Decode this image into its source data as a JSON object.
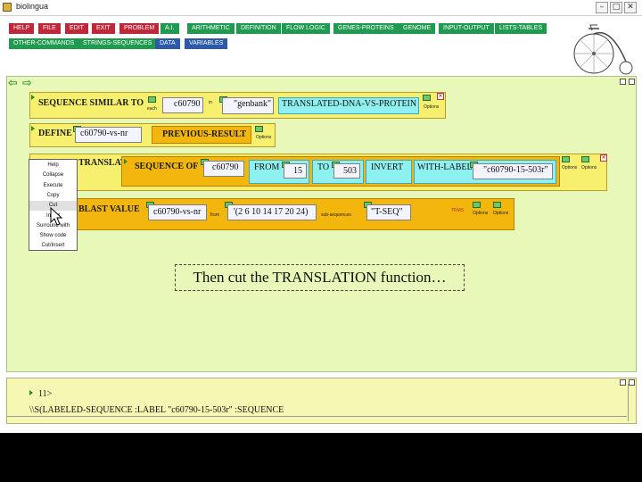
{
  "window": {
    "title": "biolingua"
  },
  "colors": {
    "help": "#c0283a",
    "file": "#c0283a",
    "edit": "#c0283a",
    "exit": "#c0283a",
    "problem": "#c0283a",
    "green_cmd": "#1f9a4f",
    "blue_cmd": "#2d5aa8",
    "workspace": "#e7f8b8",
    "function_yellow": "#f7f06f",
    "function_orange": "#f2b60c",
    "arg_cyan": "#8ff0f0"
  },
  "toolbar": {
    "help": "HELP",
    "file": "FILE",
    "edit": "EDIT",
    "exit": "EXIT",
    "problem": "PROBLEM",
    "ai": "A.I.",
    "arithmetic": "ARITHMETIC",
    "definition": "DEFINITION",
    "flow_logic": "FLOW LOGIC",
    "genes_proteins": "GENES-PROTEINS",
    "genome": "GENOME",
    "input_output": "INPUT-OUTPUT",
    "lists_tables": "LISTS-TABLES",
    "other_commands": "OTHER-COMMANDS",
    "strings_sequences": "STRINGS-SEQUENCES",
    "data": "DATA",
    "variables": "VARIABLES"
  },
  "workspace": {
    "row1": {
      "function": "SEQUENCE SIMILAR TO",
      "each": "each",
      "arg1": "c60790",
      "in": "in",
      "arg2": "\"genbank\"",
      "arg3": "TRANSLATED-DNA-VS-PROTEIN",
      "options": "Options"
    },
    "row2": {
      "function": "DEFINE",
      "arg1": "c60790-vs-nr",
      "arg2": "PREVIOUS-RESULT",
      "options": "Options"
    },
    "row3": {
      "function": "TRANSLATION-OF",
      "inner_function": "SEQUENCE OF",
      "arg1": "c60790",
      "from": "FROM",
      "from_value": "15",
      "to": "TO",
      "to_value": "503",
      "invert": "INVERT",
      "with_label": "WITH-LABEL",
      "label_value": "\"c60790-15-503r\"",
      "options": "Options"
    },
    "row4": {
      "function": "BLAST VALUE",
      "arg1": "c60790-vs-nr",
      "from": "from",
      "arg2": "'(2 6 10 14 17 20 24)",
      "sub": "sub-sequences",
      "arg3": "\"T-SEQ\"",
      "options": "Options",
      "extra": "TRMS"
    }
  },
  "context_menu": {
    "items": [
      "Help",
      "Collapse",
      "Execute",
      "Copy",
      "Cut",
      "Insert",
      "Surround with",
      "Show code",
      "Cut/Insert"
    ]
  },
  "caption": "Then cut the TRANSLATION function…",
  "output": {
    "line1": "11>",
    "line2": "\\\\S(LABELED-SEQUENCE :LABEL \"c60790-15-503r\" :SEQUENCE"
  }
}
